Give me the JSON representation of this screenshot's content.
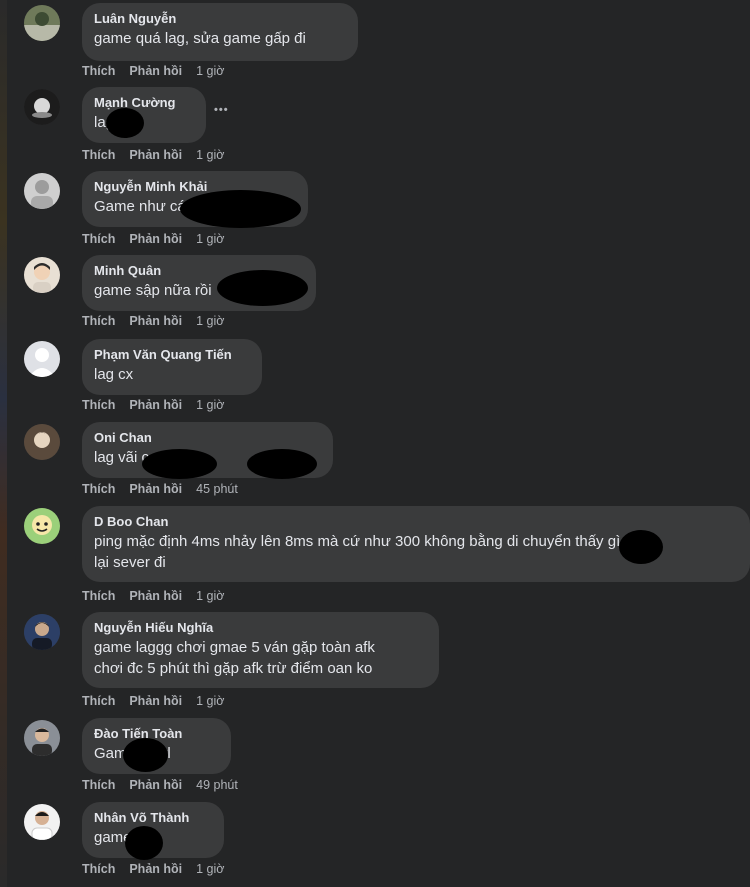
{
  "actions": {
    "like": "Thích",
    "reply": "Phản hồi"
  },
  "more_menu": "•••",
  "comments": [
    {
      "author": "Luân Nguyễn",
      "text": "game quá lag, sửa game gấp đi",
      "time": "1 giờ"
    },
    {
      "author": "Mạnh Cường",
      "text": "lag",
      "time": "1 giờ"
    },
    {
      "author": "Nguyễn Minh Khải",
      "text": "Game như cá",
      "time": "1 giờ"
    },
    {
      "author": "Minh Quân",
      "text": "game sập nữa rồi",
      "time": "1 giờ"
    },
    {
      "author": "Phạm Văn Quang Tiến",
      "text": "lag cx",
      "time": "1 giờ"
    },
    {
      "author": "Oni Chan",
      "text": "lag vãi c            e co",
      "time": "45 phút"
    },
    {
      "author": "D Boo Chan",
      "text": "ping mặc định 4ms nhảy lên 8ms mà cứ như 300 không bằng di chuyển       thấy gì , fix",
      "text2": "lại sever đi",
      "time": "1 giờ"
    },
    {
      "author": "Nguyễn Hiếu Nghĩa",
      "text": "game laggg chơi gmae 5 ván gặp toàn afk",
      "text2": "chơi đc 5 phút thì gặp afk trừ điểm oan ko",
      "time": "1 giờ"
    },
    {
      "author": "Đào Tiến Toàn",
      "text": "Game        ag vl",
      "time": "49 phút"
    },
    {
      "author": "Nhân Võ Thành",
      "text": "game",
      "time": "1 giờ"
    }
  ]
}
